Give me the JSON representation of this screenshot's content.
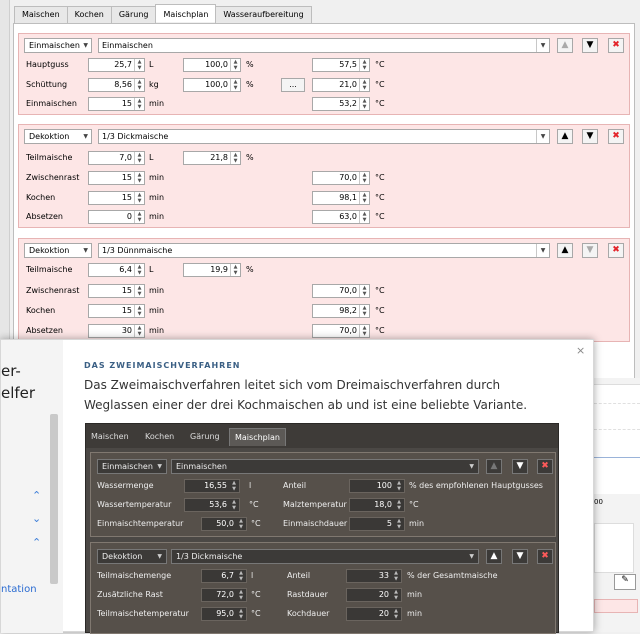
{
  "tabs": [
    "Maischen",
    "Kochen",
    "Gärung",
    "Maischplan",
    "Wasseraufbereitung"
  ],
  "active_tab": "Maischplan",
  "block1": {
    "type": "Einmaischen",
    "name": "Einmaischen",
    "rows": [
      {
        "label": "Hauptguss",
        "v1": "25,7",
        "u1": "L",
        "v2": "100,0",
        "u2": "%",
        "v3": "57,5",
        "u3": "°C"
      },
      {
        "label": "Schüttung",
        "v1": "8,56",
        "u1": "kg",
        "v2": "100,0",
        "u2": "%",
        "dots": "...",
        "v3": "21,0",
        "u3": "°C"
      },
      {
        "label": "Einmaischen",
        "v1": "15",
        "u1": "min",
        "v3": "53,2",
        "u3": "°C"
      }
    ]
  },
  "block2": {
    "type": "Dekoktion",
    "name": "1/3 Dickmaische",
    "rows": [
      {
        "label": "Teilmaische",
        "v1": "7,0",
        "u1": "L",
        "v2": "21,8",
        "u2": "%"
      },
      {
        "label": "Zwischenrast",
        "v1": "15",
        "u1": "min",
        "v3": "70,0",
        "u3": "°C"
      },
      {
        "label": "Kochen",
        "v1": "15",
        "u1": "min",
        "v3": "98,1",
        "u3": "°C"
      },
      {
        "label": "Absetzen",
        "v1": "0",
        "u1": "min",
        "v3": "63,0",
        "u3": "°C"
      }
    ]
  },
  "block3": {
    "type": "Dekoktion",
    "name": "1/3 Dünnmaische",
    "rows": [
      {
        "label": "Teilmaische",
        "v1": "6,4",
        "u1": "L",
        "v2": "19,9",
        "u2": "%"
      },
      {
        "label": "Zwischenrast",
        "v1": "15",
        "u1": "min",
        "v3": "70,0",
        "u3": "°C"
      },
      {
        "label": "Kochen",
        "v1": "15",
        "u1": "min",
        "v3": "98,2",
        "u3": "°C"
      },
      {
        "label": "Absetzen",
        "v1": "30",
        "u1": "min",
        "v3": "70,0",
        "u3": "°C"
      }
    ]
  },
  "right_fragment": {
    "tick": "00"
  },
  "dialog": {
    "side_title_1": "er-",
    "side_title_2": "elfer",
    "side_link": "ntation",
    "kicker": "DAS ZWEIMAISCHVERFAHREN",
    "paragraph": "Das Zweimaischverfahren leitet sich vom Dreimaischverfahren durch Weglassen einer der drei Kochmaischen ab und ist eine beliebte Variante.",
    "close": "×",
    "screenshot": {
      "tabs": [
        "Maischen",
        "Kochen",
        "Gärung",
        "Maischplan"
      ],
      "active_tab": "Maischplan",
      "block1": {
        "type": "Einmaischen",
        "name": "Einmaischen",
        "rows": [
          {
            "l1": "Wassermenge",
            "v1": "16,55",
            "u1": "l",
            "l2": "Anteil",
            "v2": "100",
            "u2": "% des empfohlenen Hauptgusses"
          },
          {
            "l1": "Wassertemperatur",
            "v1": "53,6",
            "u1": "°C",
            "l2": "Malztemperatur",
            "v2": "18,0",
            "u2": "°C"
          },
          {
            "l1": "Einmaischtemperatur",
            "v1": "50,0",
            "u1": "°C",
            "l2": "Einmaischdauer",
            "v2": "5",
            "u2": "min"
          }
        ]
      },
      "block2": {
        "type": "Dekoktion",
        "name": "1/3 Dickmaische",
        "rows": [
          {
            "l1": "Teilmaischemenge",
            "v1": "6,7",
            "u1": "l",
            "l2": "Anteil",
            "v2": "33",
            "u2": "% der Gesamtmaische"
          },
          {
            "l1": "Zusätzliche Rast",
            "v1": "72,0",
            "u1": "°C",
            "l2": "Rastdauer",
            "v2": "20",
            "u2": "min"
          },
          {
            "l1": "Teilmaischetemperatur",
            "v1": "95,0",
            "u1": "°C",
            "l2": "Kochdauer",
            "v2": "20",
            "u2": "min"
          }
        ]
      }
    }
  }
}
